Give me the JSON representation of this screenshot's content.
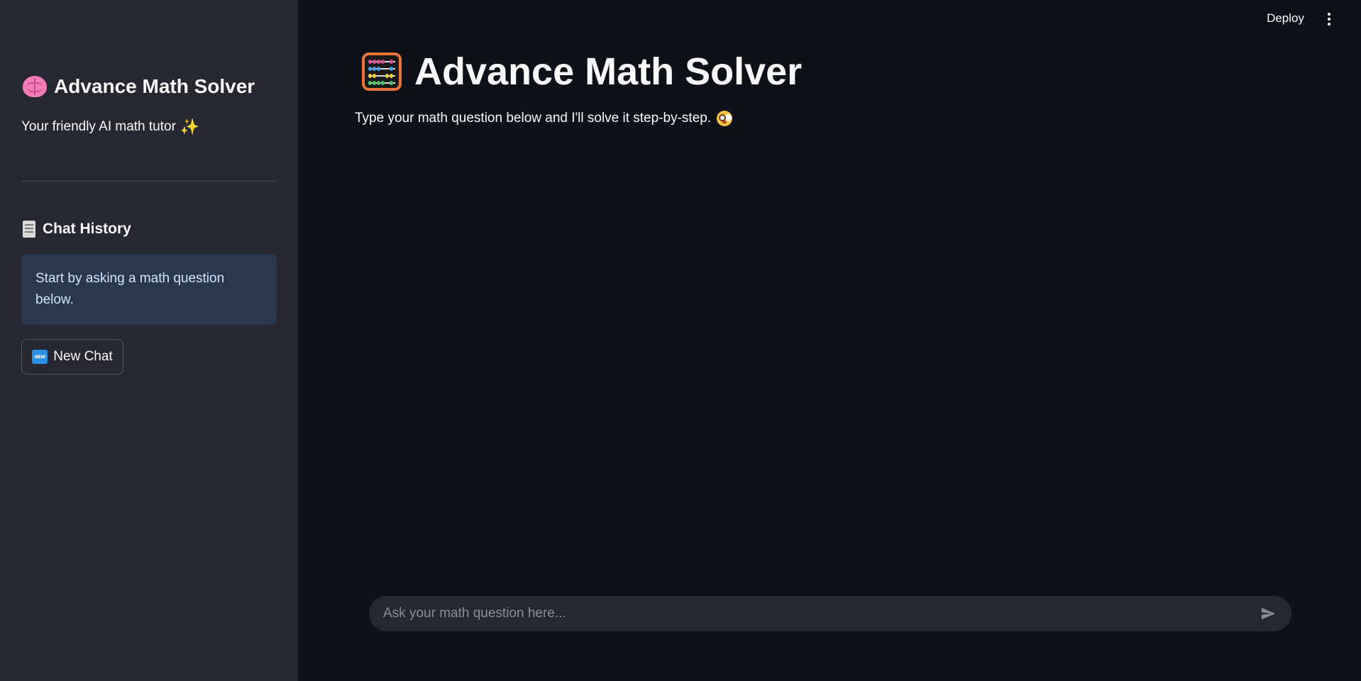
{
  "sidebar": {
    "title": "Advance Math Solver",
    "subtitle": "Your friendly AI math tutor",
    "history_heading": "Chat History",
    "info_message": "Start by asking a math question below.",
    "new_chat_badge": "NEW",
    "new_chat_label": "New Chat"
  },
  "header": {
    "deploy_label": "Deploy"
  },
  "main": {
    "title": "Advance Math Solver",
    "subtitle": "Type your math question below and I'll solve it step-by-step."
  },
  "chat_input": {
    "placeholder": "Ask your math question here...",
    "value": ""
  },
  "colors": {
    "sidebar_bg": "#262730",
    "main_bg": "#0e1117",
    "info_bg": "#29384d",
    "info_text": "#cfe5ff",
    "abacus_frame": "#e8743a"
  },
  "icons": {
    "sidebar_title": "brain-icon",
    "subtitle_suffix": "sparkles-icon",
    "history": "scroll-icon",
    "new_chat": "new-badge-icon",
    "main_title": "abacus-icon",
    "main_subtitle_suffix": "flushed-face-icon",
    "menu": "more-vertical-icon",
    "send": "send-icon"
  }
}
